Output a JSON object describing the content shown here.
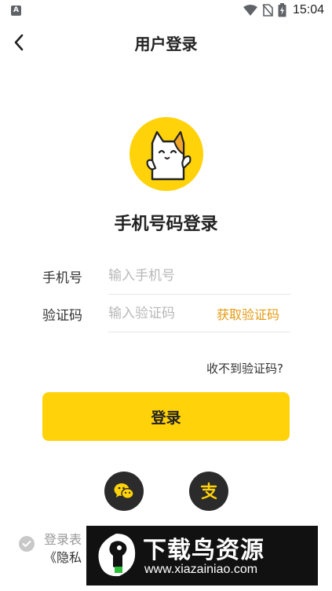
{
  "status_bar": {
    "app_icon": "A",
    "time": "15:04",
    "icons": [
      "wifi-icon",
      "no-sim-icon",
      "battery-icon"
    ]
  },
  "header": {
    "title": "用户登录",
    "back_icon": "chevron-left-icon"
  },
  "logo": {
    "icon": "cat-mascot-icon",
    "bg_color": "#ffd20a"
  },
  "login_title": "手机号码登录",
  "form": {
    "phone_label": "手机号",
    "phone_placeholder": "输入手机号",
    "code_label": "验证码",
    "code_placeholder": "输入验证码",
    "get_code": "获取验证码"
  },
  "no_code_link": "收不到验证码?",
  "login_button": "登录",
  "social": {
    "wechat_icon": "wechat-icon",
    "alipay_icon": "alipay-icon"
  },
  "agreement": {
    "line1": "登录表",
    "line2": "《隐私"
  },
  "watermark": {
    "title": "下载鸟资源",
    "url": "www.xiazainiao.com"
  },
  "colors": {
    "accent": "#ffd20a",
    "link_orange": "#e59a12",
    "social_bg": "#2b2b2b"
  }
}
